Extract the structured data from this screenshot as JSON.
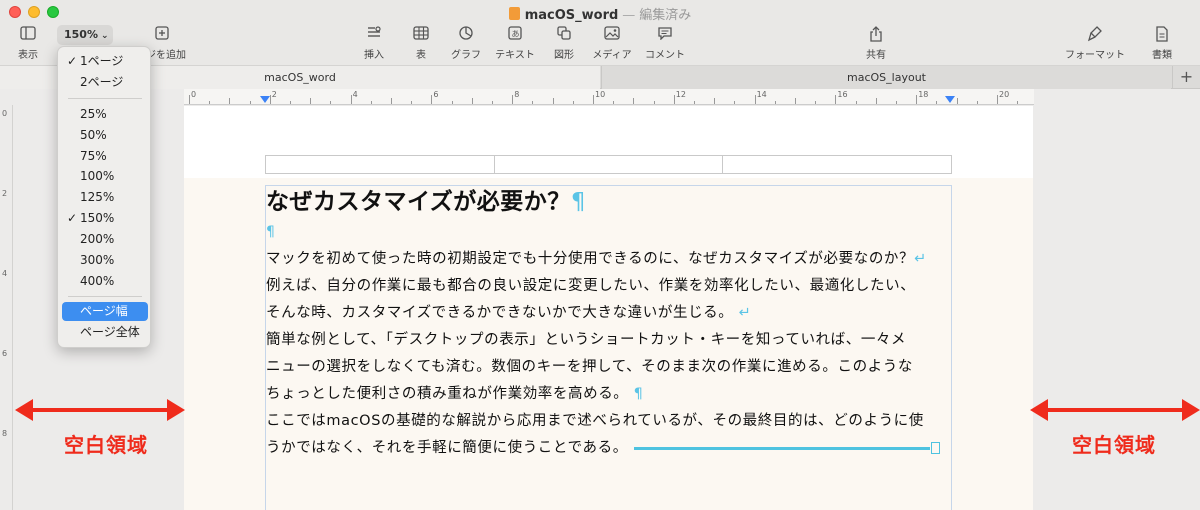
{
  "window": {
    "doc_name": "macOS_word",
    "separator": "—",
    "status": "編集済み"
  },
  "toolbar": {
    "view_label": "表示",
    "zoom_value": "150%",
    "add_page_label": "ジを追加",
    "insert_label": "挿入",
    "table_label": "表",
    "chart_label": "グラフ",
    "text_label": "テキスト",
    "shape_label": "図形",
    "media_label": "メディア",
    "comment_label": "コメント",
    "share_label": "共有",
    "format_label": "フォーマット",
    "document_label": "書類"
  },
  "tabs": {
    "active": "macOS_word",
    "inactive": "macOS_layout",
    "add": "+"
  },
  "ruler": {
    "numbers": [
      "0",
      "2",
      "4",
      "6",
      "8",
      "10",
      "12",
      "14",
      "16",
      "18",
      "20"
    ],
    "vertical_numbers": [
      "0",
      "2",
      "4",
      "6",
      "8"
    ]
  },
  "zoom_menu": {
    "items": [
      {
        "label": "1ページ",
        "checked": true
      },
      {
        "label": "2ページ",
        "checked": false
      },
      {
        "label": "25%",
        "checked": false
      },
      {
        "label": "50%",
        "checked": false
      },
      {
        "label": "75%",
        "checked": false
      },
      {
        "label": "100%",
        "checked": false
      },
      {
        "label": "125%",
        "checked": false
      },
      {
        "label": "150%",
        "checked": true
      },
      {
        "label": "200%",
        "checked": false
      },
      {
        "label": "300%",
        "checked": false
      },
      {
        "label": "400%",
        "checked": false
      },
      {
        "label": "ページ幅",
        "checked": false,
        "highlighted": true
      },
      {
        "label": "ページ全体",
        "checked": false
      }
    ],
    "check_glyph": "✓"
  },
  "document": {
    "heading": "なぜカスタマイズが必要か？",
    "pilcrow": "¶",
    "linebreak": "↵",
    "lines": [
      "マックを初めて使った時の初期設定でも十分使用できるのに、なぜカスタマイズが必要なのか？",
      "例えば、自分の作業に最も都合の良い設定に変更したい、作業を効率化したい、最適化したい、",
      "そんな時、カスタマイズできるかできないかで大きな違いが生じる。",
      "簡単な例として、「デスクトップの表示」というショートカット・キーを知っていれば、一々メ",
      "ニューの選択をしなくても済む。数個のキーを押して、そのまま次の作業に進める。このような",
      "ちょっとした便利さの積み重ねが作業効率を高める。",
      "ここではmacOSの基礎的な解説から応用まで述べられているが、その最終目的は、どのように使",
      "うかではなく、それを手軽に簡便に使うことである。"
    ]
  },
  "annotations": {
    "left_label": "空白領域",
    "right_label": "空白領域",
    "color": "#ef2b1c"
  }
}
